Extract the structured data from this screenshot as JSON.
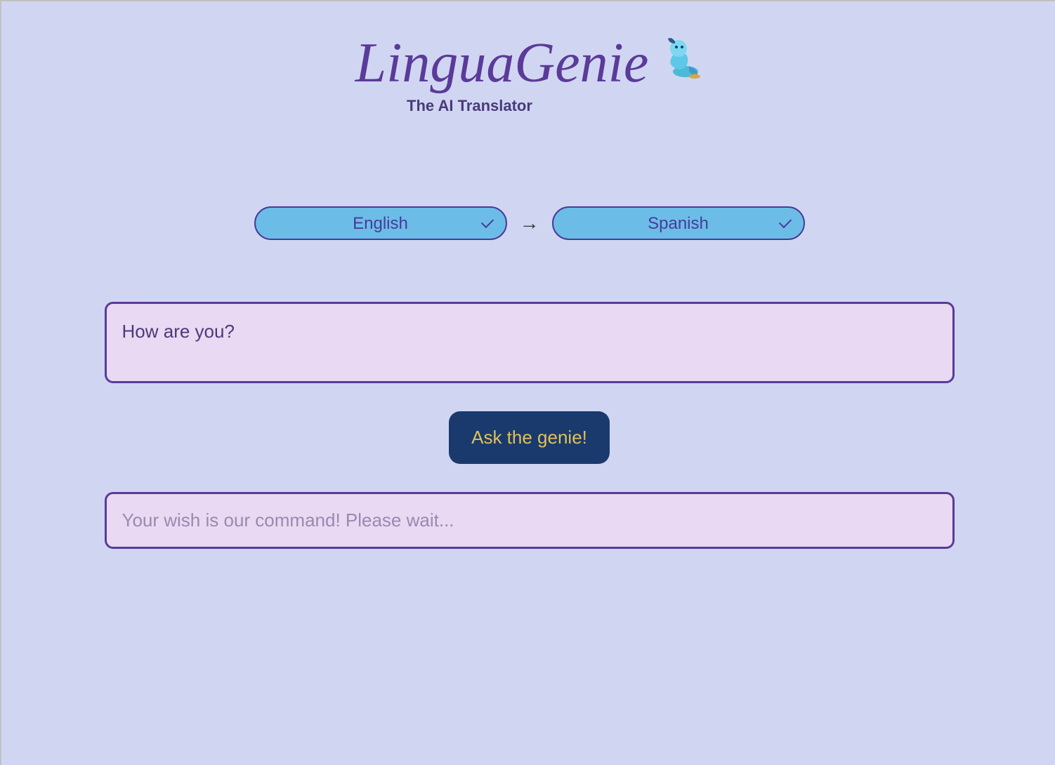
{
  "header": {
    "logo_text": "LinguaGenie",
    "tagline": "The AI Translator"
  },
  "languages": {
    "source_selected": "English",
    "target_selected": "Spanish"
  },
  "input": {
    "value": "How are you?"
  },
  "button": {
    "label": "Ask the genie!"
  },
  "output": {
    "text": "Your wish is our command! Please wait..."
  },
  "colors": {
    "background": "#d0d6f2",
    "accent_purple": "#5b3a99",
    "select_blue": "#6bbde8",
    "button_navy": "#1a3a6e",
    "button_gold": "#e0c05a",
    "box_lavender": "#e9d9f2"
  }
}
